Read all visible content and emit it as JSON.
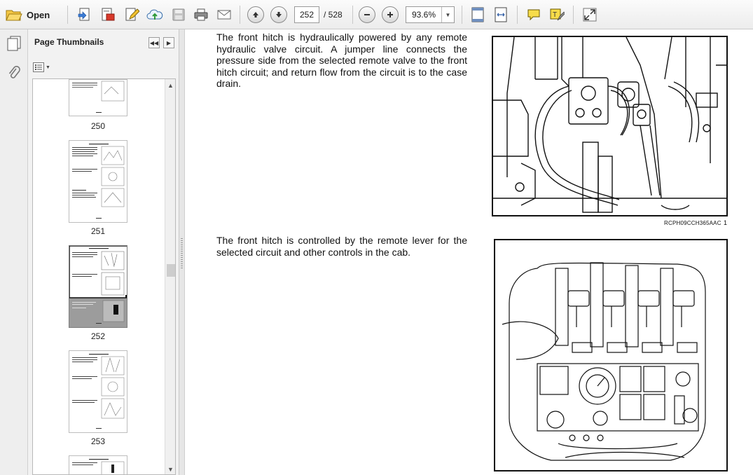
{
  "toolbar": {
    "open_label": "Open",
    "page_current": "252",
    "page_total": "/ 528",
    "zoom_value": "93.6%",
    "icons": [
      "open-folder-icon",
      "create-pdf-icon",
      "export-pdf-icon",
      "edit-pdf-icon",
      "upload-cloud-icon",
      "save-icon",
      "print-icon",
      "email-icon",
      "previous-page-icon",
      "next-page-icon",
      "zoom-out-icon",
      "zoom-in-icon",
      "fit-page-icon",
      "full-width-icon",
      "comment-icon",
      "highlight-icon",
      "expand-icon"
    ]
  },
  "nav": {
    "icons": [
      "page-thumbnails-icon",
      "attachments-icon"
    ]
  },
  "thumbnails_panel": {
    "title": "Page Thumbnails",
    "pages": [
      {
        "number": "250"
      },
      {
        "number": "251"
      },
      {
        "number": "252",
        "selected": true
      },
      {
        "number": "253"
      }
    ]
  },
  "document": {
    "paragraph_1": "The front hitch is hydraulically powered by any remote hydraulic valve circuit. A jumper line connects the pressure side from the selected remote valve to the front hitch circuit; and return flow from the circuit is to the case drain.",
    "figure_1_caption": "RCPH09CCH365AAC",
    "figure_1_number": "1",
    "paragraph_2": "The front hitch is controlled by the remote lever for the selected circuit and other controls in the cab."
  },
  "colors": {
    "toolbar_bg": "#efefef",
    "panel_bg": "#f2f2f2",
    "selected_thumb": "#9c9c9c",
    "accent_folder": "#e6b800"
  }
}
